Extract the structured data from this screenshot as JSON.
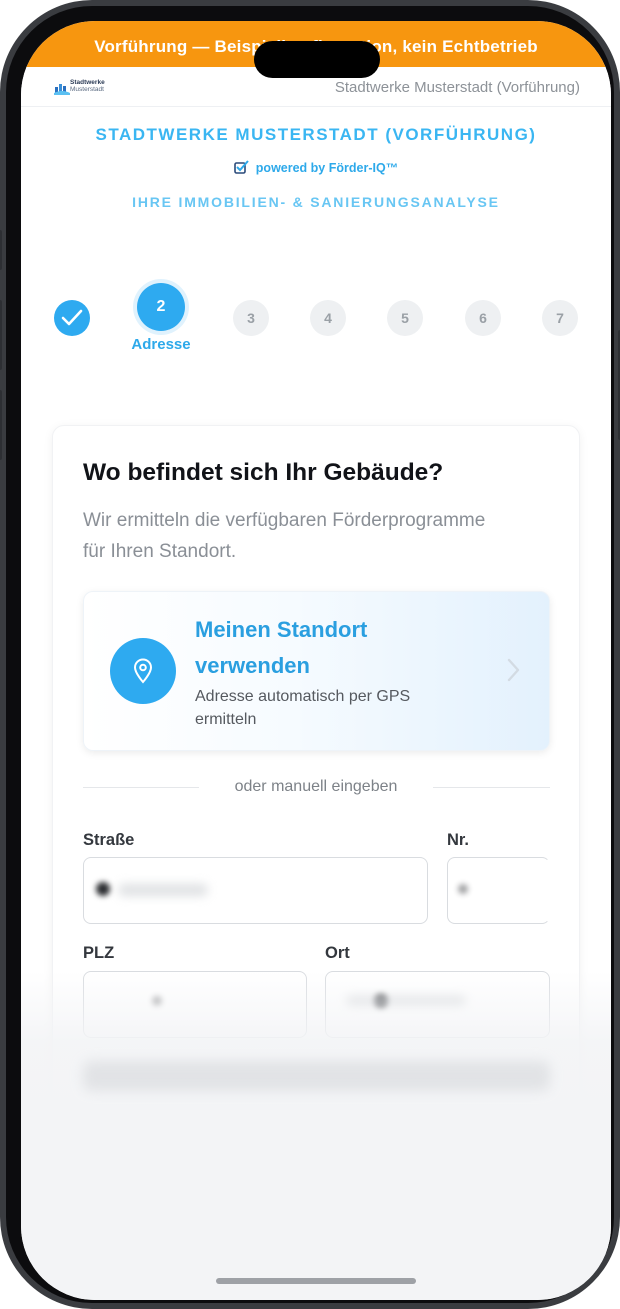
{
  "banner": {
    "text": "Vorführung — Beispielkonfiguration, kein Echtbetrieb"
  },
  "header": {
    "logo_line1": "Stadtwerke",
    "logo_line2": "Musterstadt",
    "title": "Stadtwerke Musterstadt (Vorführung)"
  },
  "brand": {
    "title": "STADTWERKE MUSTERSTADT (VORFÜHRUNG)",
    "powered": "powered by Förder-IQ™",
    "subtitle": "IHRE IMMOBILIEN- & SANIERUNGSANALYSE"
  },
  "stepper": {
    "current_step": 2,
    "current_label": "Adresse",
    "steps": [
      "1",
      "2",
      "3",
      "4",
      "5",
      "6",
      "7"
    ]
  },
  "card": {
    "title": "Wo befindet sich Ihr Gebäude?",
    "description": "Wir ermitteln die verfügbaren Förderprogramme für Ihren Standort.",
    "gps": {
      "title": "Meinen Standort verwenden",
      "subtitle": "Adresse automatisch per GPS ermitteln"
    },
    "divider": "oder manuell eingeben",
    "fields": {
      "street_label": "Straße",
      "number_label": "Nr.",
      "zip_label": "PLZ",
      "city_label": "Ort"
    }
  },
  "colors": {
    "banner": "#f7960f",
    "accent": "#2eaaf0",
    "brand_text": "#3ab6f2"
  },
  "icons": [
    "check-icon",
    "location-pin-icon",
    "chevron-right-icon",
    "checkbox-icon"
  ]
}
